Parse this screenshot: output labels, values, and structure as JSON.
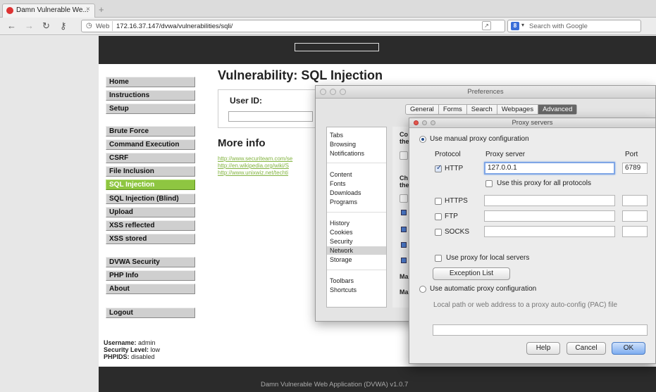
{
  "browser": {
    "tab_title": "Damn Vulnerable We...",
    "tab_close": "×",
    "new_tab": "+",
    "nav": {
      "back": "←",
      "forward": "→",
      "reload": "↻",
      "key": "⚷"
    },
    "url_scheme_label": "Web",
    "url": "172.16.37.147/dvwa/vulnerabilities/sqli/",
    "search_placeholder": "Search with Google",
    "search_engine_letter": "8",
    "search_caret": "▾"
  },
  "dvwa": {
    "menu": [
      {
        "label": "Home"
      },
      {
        "label": "Instructions"
      },
      {
        "label": "Setup"
      },
      {
        "label": "Brute Force"
      },
      {
        "label": "Command Execution"
      },
      {
        "label": "CSRF"
      },
      {
        "label": "File Inclusion"
      },
      {
        "label": "SQL Injection",
        "active": true
      },
      {
        "label": "SQL Injection (Blind)"
      },
      {
        "label": "Upload"
      },
      {
        "label": "XSS reflected"
      },
      {
        "label": "XSS stored"
      },
      {
        "label": "DVWA Security"
      },
      {
        "label": "PHP Info"
      },
      {
        "label": "About"
      },
      {
        "label": "Logout"
      }
    ],
    "title": "Vulnerability: SQL Injection",
    "user_id_label": "User ID:",
    "more_info": "More info",
    "links": [
      "http://www.securiteam.com/se",
      "http://en.wikipedia.org/wiki/S",
      "http://www.unixwiz.net/techti"
    ],
    "status": {
      "username_label": "Username:",
      "username": "admin",
      "security_label": "Security Level:",
      "security": "low",
      "phpids_label": "PHPIDS:",
      "phpids": "disabled"
    },
    "footer": "Damn Vulnerable Web Application (DVWA) v1.0.7"
  },
  "preferences": {
    "title": "Preferences",
    "tabs": [
      "General",
      "Forms",
      "Search",
      "Webpages",
      "Advanced"
    ],
    "selected_tab": "Advanced",
    "categories_groups": [
      [
        "Tabs",
        "Browsing",
        "Notifications"
      ],
      [
        "Content",
        "Fonts",
        "Downloads",
        "Programs"
      ],
      [
        "History",
        "Cookies",
        "Security",
        "Network",
        "Storage"
      ],
      [
        "Toolbars",
        "Shortcuts"
      ]
    ],
    "selected_category": "Network",
    "right_fragments": [
      "Co",
      "the",
      "Ch",
      "the",
      "Ma",
      "Ma"
    ]
  },
  "proxy": {
    "title": "Proxy servers",
    "manual_label": "Use manual proxy configuration",
    "col_protocol": "Protocol",
    "col_server": "Proxy server",
    "col_port": "Port",
    "rows": [
      {
        "protocol": "HTTP",
        "checked": true,
        "server": "127.0.0.1",
        "port": "6789"
      },
      {
        "protocol": "HTTPS",
        "checked": false,
        "server": "",
        "port": ""
      },
      {
        "protocol": "FTP",
        "checked": false,
        "server": "",
        "port": ""
      },
      {
        "protocol": "SOCKS",
        "checked": false,
        "server": "",
        "port": ""
      }
    ],
    "all_protocols_label": "Use this proxy for all protocols",
    "local_label": "Use proxy for local servers",
    "exception_button": "Exception List",
    "auto_label": "Use automatic proxy configuration",
    "pac_hint": "Local path or web address to a proxy auto-config (PAC) file",
    "pac_value": "",
    "help": "Help",
    "cancel": "Cancel",
    "ok": "OK"
  }
}
